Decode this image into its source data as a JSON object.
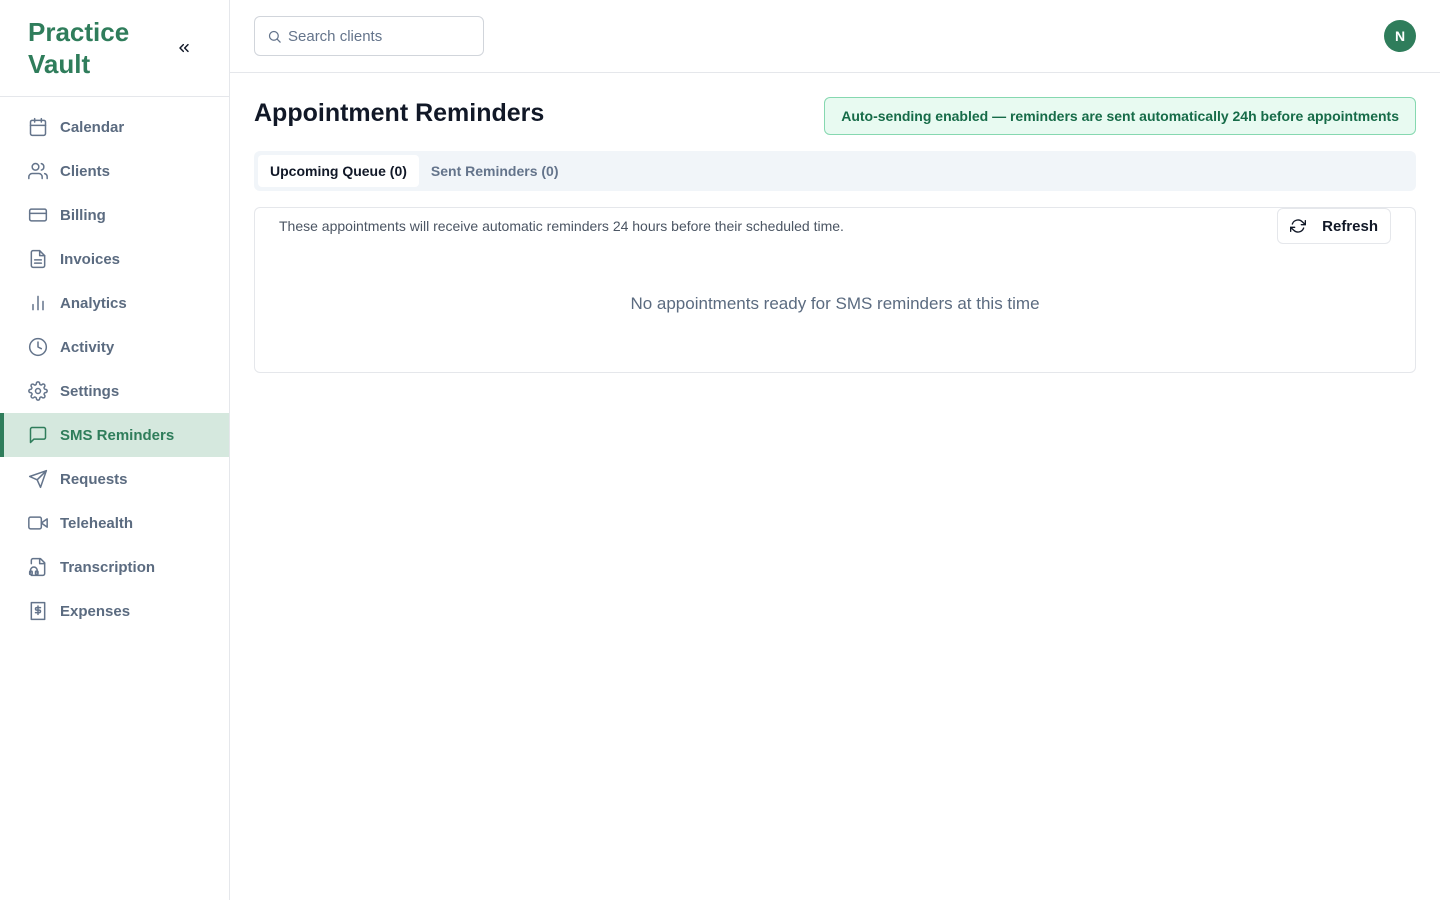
{
  "app": {
    "name": "Practice Vault"
  },
  "sidebar": {
    "collapse_icon": "chevrons-left-icon",
    "items": [
      {
        "label": "Calendar",
        "icon": "calendar-icon",
        "active": false
      },
      {
        "label": "Clients",
        "icon": "users-icon",
        "active": false
      },
      {
        "label": "Billing",
        "icon": "credit-card-icon",
        "active": false
      },
      {
        "label": "Invoices",
        "icon": "file-text-icon",
        "active": false
      },
      {
        "label": "Analytics",
        "icon": "bar-chart-icon",
        "active": false
      },
      {
        "label": "Activity",
        "icon": "clock-icon",
        "active": false
      },
      {
        "label": "Settings",
        "icon": "gear-icon",
        "active": false
      },
      {
        "label": "SMS Reminders",
        "icon": "message-square-icon",
        "active": true
      },
      {
        "label": "Requests",
        "icon": "send-icon",
        "active": false
      },
      {
        "label": "Telehealth",
        "icon": "video-icon",
        "active": false
      },
      {
        "label": "Transcription",
        "icon": "file-audio-icon",
        "active": false
      },
      {
        "label": "Expenses",
        "icon": "receipt-dollar-icon",
        "active": false
      }
    ]
  },
  "topbar": {
    "search": {
      "placeholder": "Search clients",
      "value": ""
    },
    "avatar_initial": "N"
  },
  "page": {
    "title": "Appointment Reminders",
    "banner": "Auto-sending enabled — reminders are sent automatically 24h before appointments",
    "tabs": [
      {
        "label": "Upcoming Queue (0)",
        "active": true
      },
      {
        "label": "Sent Reminders (0)",
        "active": false
      }
    ],
    "queue": {
      "description": "These appointments will receive automatic reminders 24 hours before their scheduled time.",
      "refresh_label": "Refresh",
      "empty_message": "No appointments ready for SMS reminders at this time"
    }
  },
  "colors": {
    "brand": "#2f7d5b",
    "active_nav_bg": "#d5e8de",
    "banner_bg": "#e8faf1",
    "banner_border": "#86d8b0",
    "banner_text": "#166b48"
  }
}
